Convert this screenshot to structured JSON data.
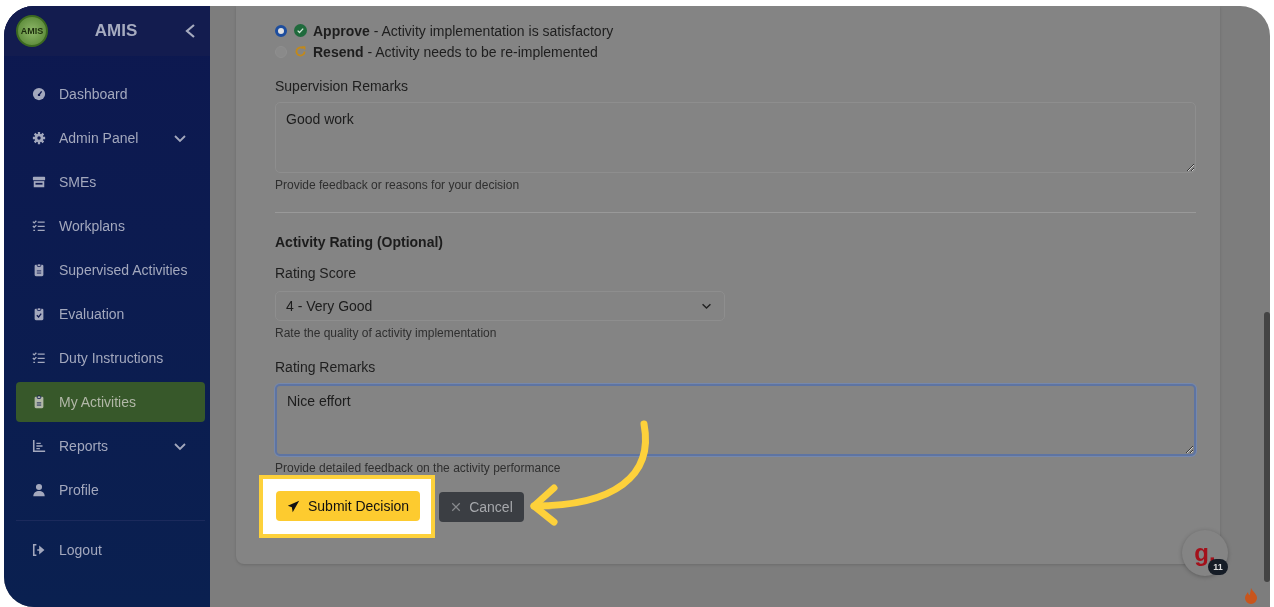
{
  "sidebar": {
    "logo_text": "AMIS",
    "brand": "AMIS",
    "items": [
      {
        "label": "Dashboard",
        "selected": false,
        "expandable": false
      },
      {
        "label": "Admin Panel",
        "selected": false,
        "expandable": true
      },
      {
        "label": "SMEs",
        "selected": false,
        "expandable": false
      },
      {
        "label": "Workplans",
        "selected": false,
        "expandable": false
      },
      {
        "label": "Supervised Activities",
        "selected": false,
        "expandable": false
      },
      {
        "label": "Evaluation",
        "selected": false,
        "expandable": false
      },
      {
        "label": "Duty Instructions",
        "selected": false,
        "expandable": false
      },
      {
        "label": "My Activities",
        "selected": true,
        "expandable": false
      },
      {
        "label": "Reports",
        "selected": false,
        "expandable": true
      },
      {
        "label": "Profile",
        "selected": false,
        "expandable": false
      }
    ],
    "logout": "Logout"
  },
  "decision": {
    "options": [
      {
        "kind": "approve",
        "label": "**Approve** - Activity implementation is satisfactory",
        "selected": true
      },
      {
        "kind": "resend",
        "label": "**Resend** - Activity needs to be re-implemented",
        "selected": false
      }
    ]
  },
  "supervision_remarks": {
    "label": "Supervision Remarks",
    "value": "Good work",
    "help": "Provide feedback or reasons for your decision"
  },
  "rating": {
    "heading": "Activity Rating (Optional)",
    "score_label": "Rating Score",
    "score_value": "4 - Very Good",
    "score_help": "Rate the quality of activity implementation",
    "remarks_label": "Rating Remarks",
    "remarks_value": "Nice effort",
    "remarks_help": "Provide detailed feedback on the activity performance"
  },
  "actions": [
    {
      "kind": "primary",
      "label": "Submit Decision",
      "highlighted": true
    },
    {
      "kind": "secondary",
      "label": "Cancel",
      "highlighted": false
    }
  ],
  "chat_widget": {
    "letter": "g.",
    "badge": "11"
  }
}
